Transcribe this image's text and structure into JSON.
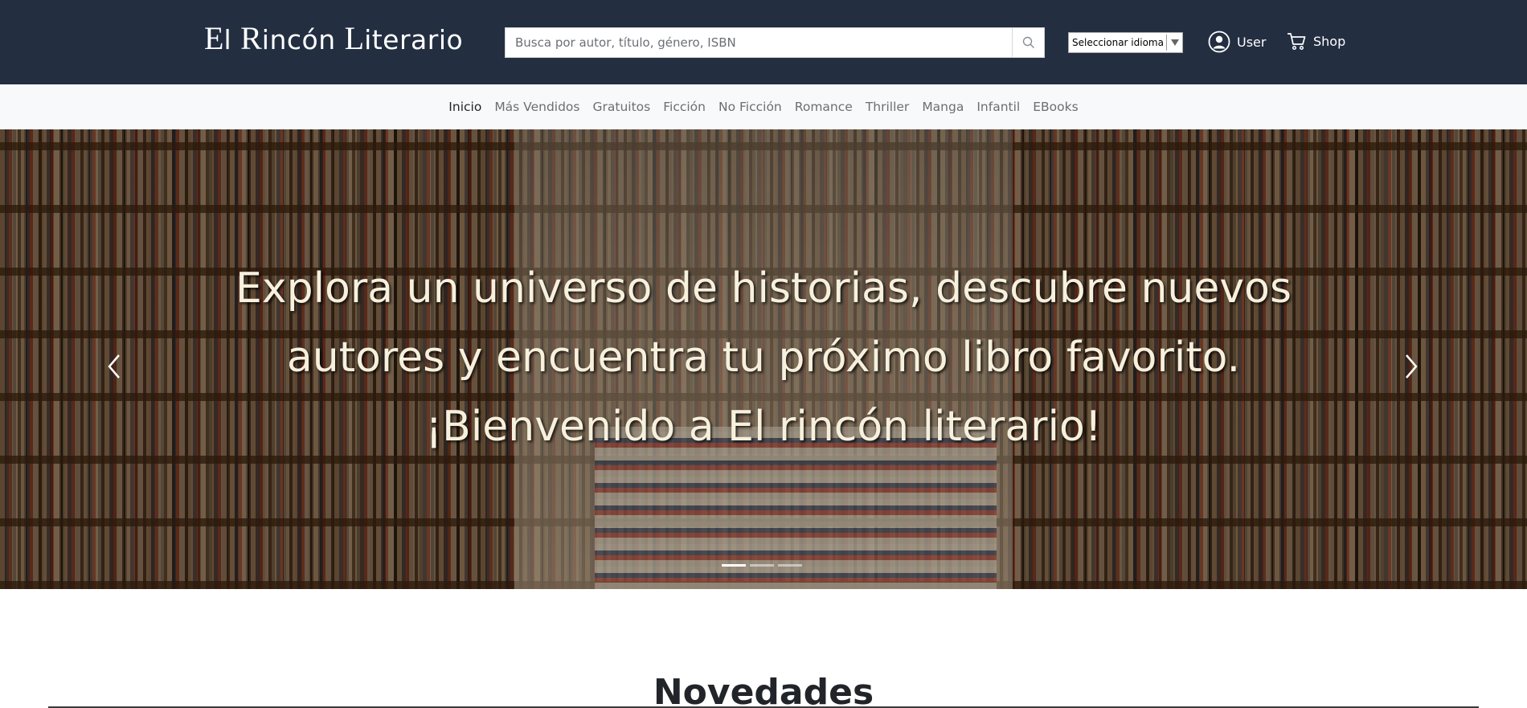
{
  "header": {
    "logo": {
      "first_initial": "E",
      "first_rest": "l ",
      "second_initial": "R",
      "second_rest": "incón ",
      "third_initial": "L",
      "third_rest": "iterario"
    },
    "search": {
      "placeholder": "Busca por autor, título, género, ISBN",
      "value": "",
      "button_icon": "search-icon"
    },
    "language_select": {
      "selected": "Seleccionar idioma",
      "arrow_icon": "triangle-down-icon"
    },
    "user": {
      "label": "User",
      "icon": "user-circle-icon"
    },
    "shop": {
      "label": "Shop",
      "icon": "cart-icon"
    }
  },
  "colors": {
    "header_bg": "#232e41",
    "nav_bg": "#f8f9fa",
    "nav_text": "#6b6f73",
    "nav_active": "#1f2328"
  },
  "nav": {
    "items": [
      {
        "label": "Inicio",
        "active": true
      },
      {
        "label": "Más Vendidos",
        "active": false
      },
      {
        "label": "Gratuitos",
        "active": false
      },
      {
        "label": "Ficción",
        "active": false
      },
      {
        "label": "No Ficción",
        "active": false
      },
      {
        "label": "Romance",
        "active": false
      },
      {
        "label": "Thriller",
        "active": false
      },
      {
        "label": "Manga",
        "active": false
      },
      {
        "label": "Infantil",
        "active": false
      },
      {
        "label": "EBooks",
        "active": false
      }
    ]
  },
  "hero": {
    "lines": [
      "Explora un universo de historias, descubre nuevos",
      "autores y encuentra tu próximo libro favorito.",
      "¡Bienvenido a El rincón literario!"
    ],
    "prev_icon": "chevron-left-icon",
    "next_icon": "chevron-right-icon",
    "slides": 3,
    "active_slide": 1
  },
  "section": {
    "title": "Novedades"
  }
}
